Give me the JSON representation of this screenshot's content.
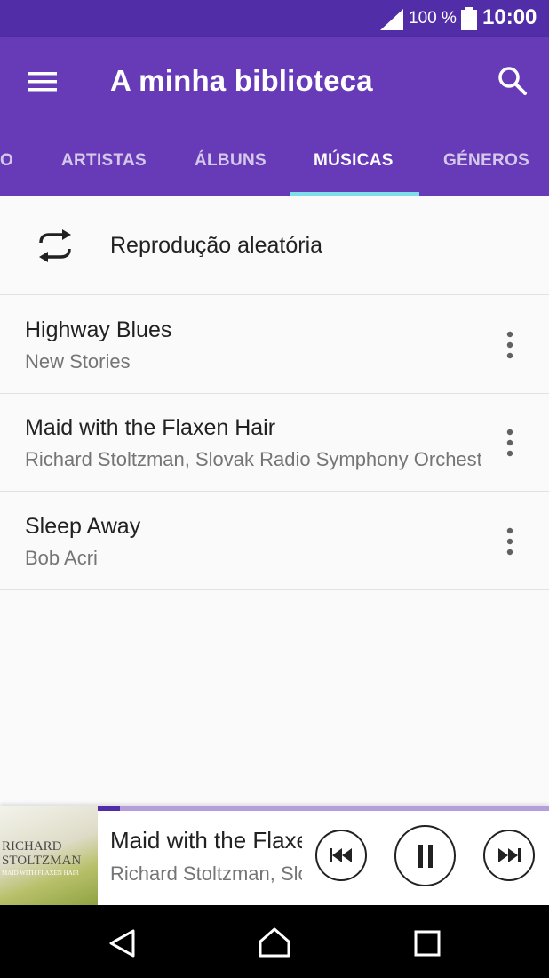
{
  "status_bar": {
    "battery_percent": "100 %",
    "time": "10:00"
  },
  "app_bar": {
    "title": "A minha biblioteca",
    "menu_icon": "hamburger-menu-icon",
    "search_icon": "search-icon"
  },
  "tabs": [
    {
      "label": "O",
      "active": false
    },
    {
      "label": "ARTISTAS",
      "active": false
    },
    {
      "label": "ÁLBUNS",
      "active": false
    },
    {
      "label": "MÚSICAS",
      "active": true
    },
    {
      "label": "GÉNEROS",
      "active": false
    }
  ],
  "shuffle": {
    "label": "Reprodução aleatória",
    "icon": "shuffle-repeat-icon"
  },
  "songs": [
    {
      "title": "Highway Blues",
      "artist": "New Stories"
    },
    {
      "title": "Maid with the Flaxen Hair",
      "artist": "Richard Stoltzman, Slovak Radio Symphony Orchestra"
    },
    {
      "title": "Sleep Away",
      "artist": "Bob Acri"
    }
  ],
  "now_playing": {
    "title": "Maid with the Flaxen Hair",
    "artist": "Richard Stoltzman, Slovak Radio Symphony Orchestra",
    "progress": 0.05,
    "album_art_text": [
      "RICHARD",
      "STOLTZMAN",
      "MAID WITH FLAXEN HAIR"
    ],
    "controls": [
      "previous-track-icon",
      "pause-icon",
      "next-track-icon"
    ]
  },
  "nav_bar": {
    "buttons": [
      "back-icon",
      "home-icon",
      "recents-icon"
    ]
  },
  "colors": {
    "status_bar": "#512da8",
    "app_bar": "#673ab7",
    "tab_indicator": "#80deea",
    "progress": "#512da8"
  }
}
